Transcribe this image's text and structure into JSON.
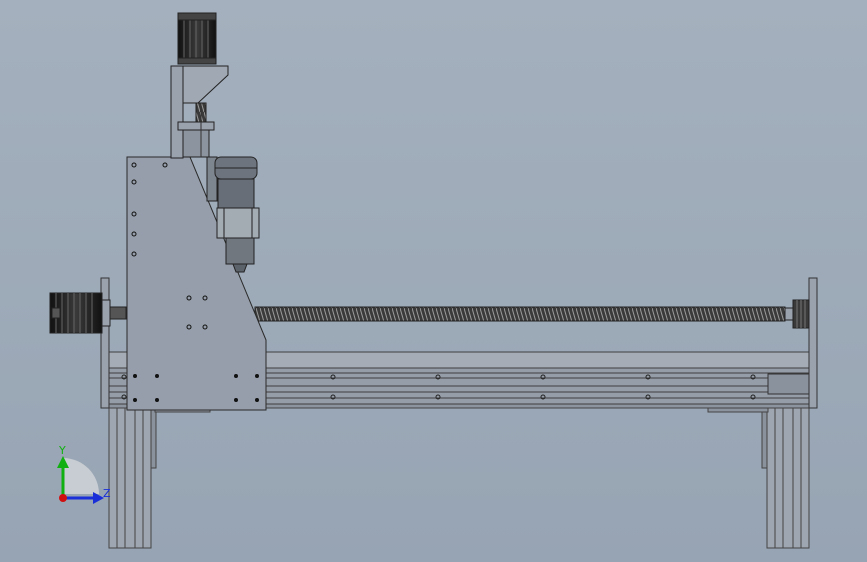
{
  "viewport": {
    "background_top": "#a4b0bd",
    "background_bottom": "#97a4b3"
  },
  "model": {
    "frame_color": "#8f98a6",
    "steel_color": "#9aa2ac",
    "motor_color": "#1e1e1e",
    "spindle_color": "#707780"
  },
  "triad": {
    "y_label": "Y",
    "z_label": "Z",
    "y_color": "#10b010",
    "z_color": "#1a2fd8",
    "x_color": "#d01010"
  }
}
